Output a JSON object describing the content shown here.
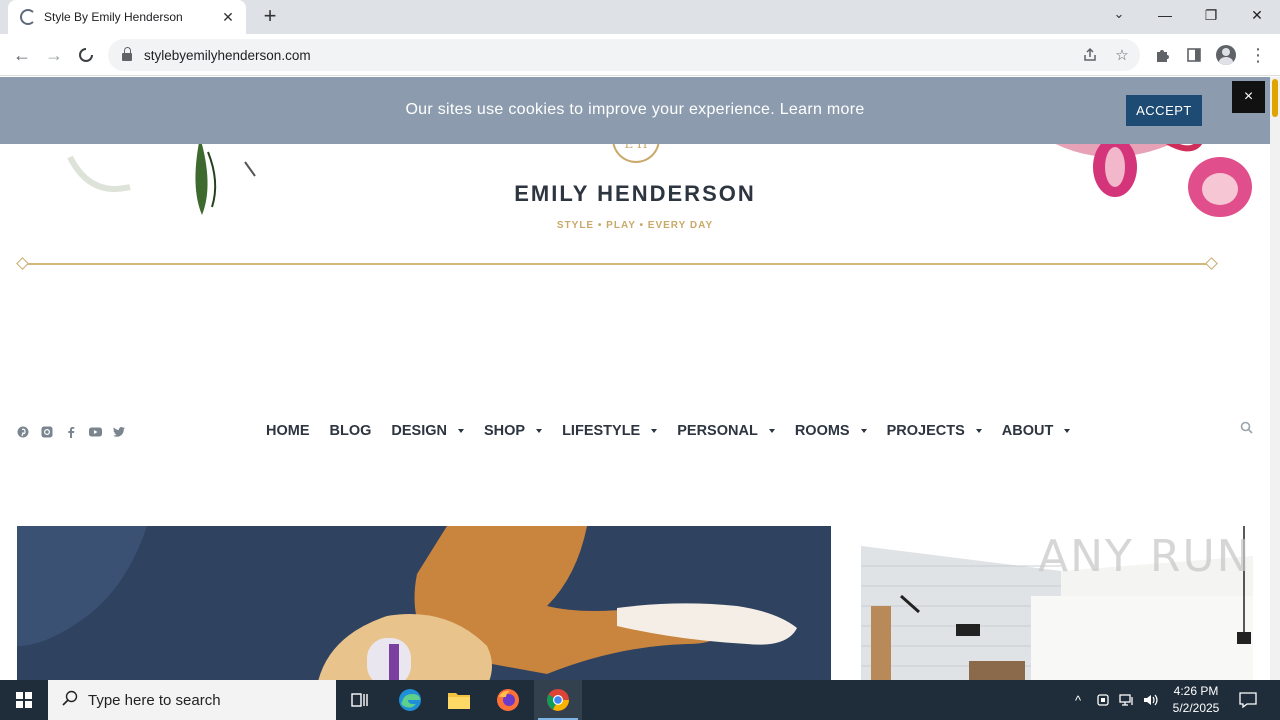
{
  "browser": {
    "tab_title": "Style By Emily Henderson",
    "url": "stylebyemilyhenderson.com"
  },
  "cookie": {
    "message": "Our sites use cookies to improve your experience.",
    "learn_more": "Learn more",
    "accept_label": "ACCEPT",
    "close_label": "×"
  },
  "site": {
    "monogram": "E H",
    "brand": "EMILY HENDERSON",
    "tagline": "STYLE  •  PLAY  •  EVERY DAY"
  },
  "nav": {
    "items": [
      {
        "label": "HOME",
        "has_dropdown": false
      },
      {
        "label": "BLOG",
        "has_dropdown": false
      },
      {
        "label": "DESIGN",
        "has_dropdown": true
      },
      {
        "label": "SHOP",
        "has_dropdown": true
      },
      {
        "label": "LIFESTYLE",
        "has_dropdown": true
      },
      {
        "label": "PERSONAL",
        "has_dropdown": true
      },
      {
        "label": "ROOMS",
        "has_dropdown": true
      },
      {
        "label": "PROJECTS",
        "has_dropdown": true
      },
      {
        "label": "ABOUT",
        "has_dropdown": true
      }
    ],
    "social": [
      "pinterest-icon",
      "instagram-icon",
      "facebook-icon",
      "youtube-icon",
      "twitter-icon"
    ]
  },
  "watermark": "ANY RUN",
  "taskbar": {
    "search_placeholder": "Type here to search",
    "time": "4:26 PM",
    "date": "5/2/2025"
  },
  "colors": {
    "cookie_bar": "#8c9cae",
    "accept_button": "#1e4b73",
    "gold": "#c9a96a",
    "brand_text": "#2d3540",
    "taskbar": "#1f2c3a"
  }
}
